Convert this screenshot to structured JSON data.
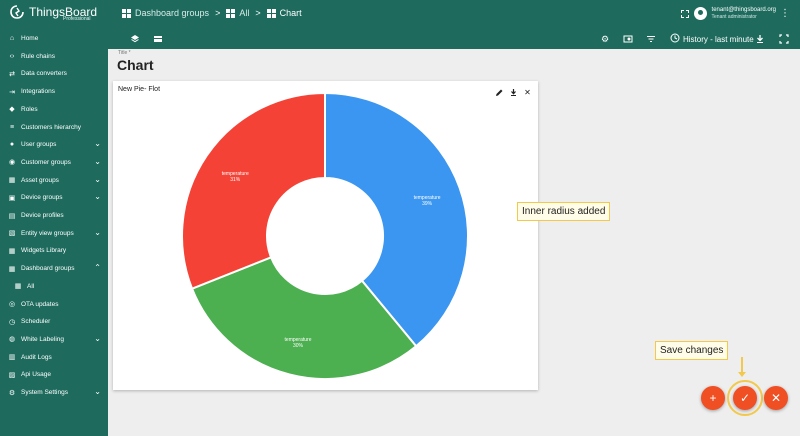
{
  "app": {
    "logo_title": "ThingsBoard",
    "logo_subtitle": "Professional"
  },
  "breadcrumbs": [
    {
      "label": "Dashboard groups",
      "icon": "grid-icon"
    },
    {
      "label": "All",
      "icon": "grid-icon"
    },
    {
      "label": "Chart",
      "icon": "grid-icon"
    }
  ],
  "breadcrumb_separator": ">",
  "user": {
    "email": "tenant@thingsboard.org",
    "role": "Tenant administrator"
  },
  "toolbar": {
    "history_label": "History - last minute"
  },
  "sidebar": {
    "items": [
      {
        "label": "Home",
        "icon": "home-icon",
        "chevron": false
      },
      {
        "label": "Rule chains",
        "icon": "code-arrows-icon",
        "chevron": false
      },
      {
        "label": "Data converters",
        "icon": "transform-icon",
        "chevron": false
      },
      {
        "label": "Integrations",
        "icon": "input-icon",
        "chevron": false
      },
      {
        "label": "Roles",
        "icon": "shield-icon",
        "chevron": false
      },
      {
        "label": "Customers hierarchy",
        "icon": "sort-icon",
        "chevron": false
      },
      {
        "label": "User groups",
        "icon": "account-icon",
        "chevron": true
      },
      {
        "label": "Customer groups",
        "icon": "group-icon",
        "chevron": true
      },
      {
        "label": "Asset groups",
        "icon": "domain-icon",
        "chevron": true
      },
      {
        "label": "Device groups",
        "icon": "devices-icon",
        "chevron": true
      },
      {
        "label": "Device profiles",
        "icon": "profile-icon",
        "chevron": false
      },
      {
        "label": "Entity view groups",
        "icon": "entity-icon",
        "chevron": true
      },
      {
        "label": "Widgets Library",
        "icon": "widgets-icon",
        "chevron": false
      },
      {
        "label": "Dashboard groups",
        "icon": "dashboard-icon",
        "chevron": true,
        "expanded": true
      },
      {
        "label": "All",
        "icon": "grid-icon",
        "chevron": false,
        "sub": true
      },
      {
        "label": "OTA updates",
        "icon": "update-icon",
        "chevron": false
      },
      {
        "label": "Scheduler",
        "icon": "clock-icon",
        "chevron": false
      },
      {
        "label": "White Labeling",
        "icon": "palette-icon",
        "chevron": true
      },
      {
        "label": "Audit Logs",
        "icon": "track-icon",
        "chevron": false
      },
      {
        "label": "Api Usage",
        "icon": "chart-icon",
        "chevron": false
      },
      {
        "label": "System Settings",
        "icon": "gear-icon",
        "chevron": true
      }
    ]
  },
  "content": {
    "title_caption": "Title *",
    "page_title": "Chart"
  },
  "widget": {
    "title": "New Pie- Flot"
  },
  "chart_data": {
    "type": "pie",
    "inner_radius": true,
    "slices": [
      {
        "name": "temperature",
        "percent": 39,
        "color": "#3a96f0"
      },
      {
        "name": "temperature",
        "percent": 30,
        "color": "#4caf50"
      },
      {
        "name": "temperature",
        "percent": 31,
        "color": "#f44336"
      }
    ]
  },
  "callouts": {
    "inner_radius": "Inner radius added",
    "save_changes": "Save changes"
  },
  "fabs": {
    "add": "+",
    "save": "✓",
    "cancel": "✕"
  },
  "colors": {
    "sidebar": "#1e6b5e",
    "accent": "#f04e23",
    "highlight": "#f2c94c"
  }
}
